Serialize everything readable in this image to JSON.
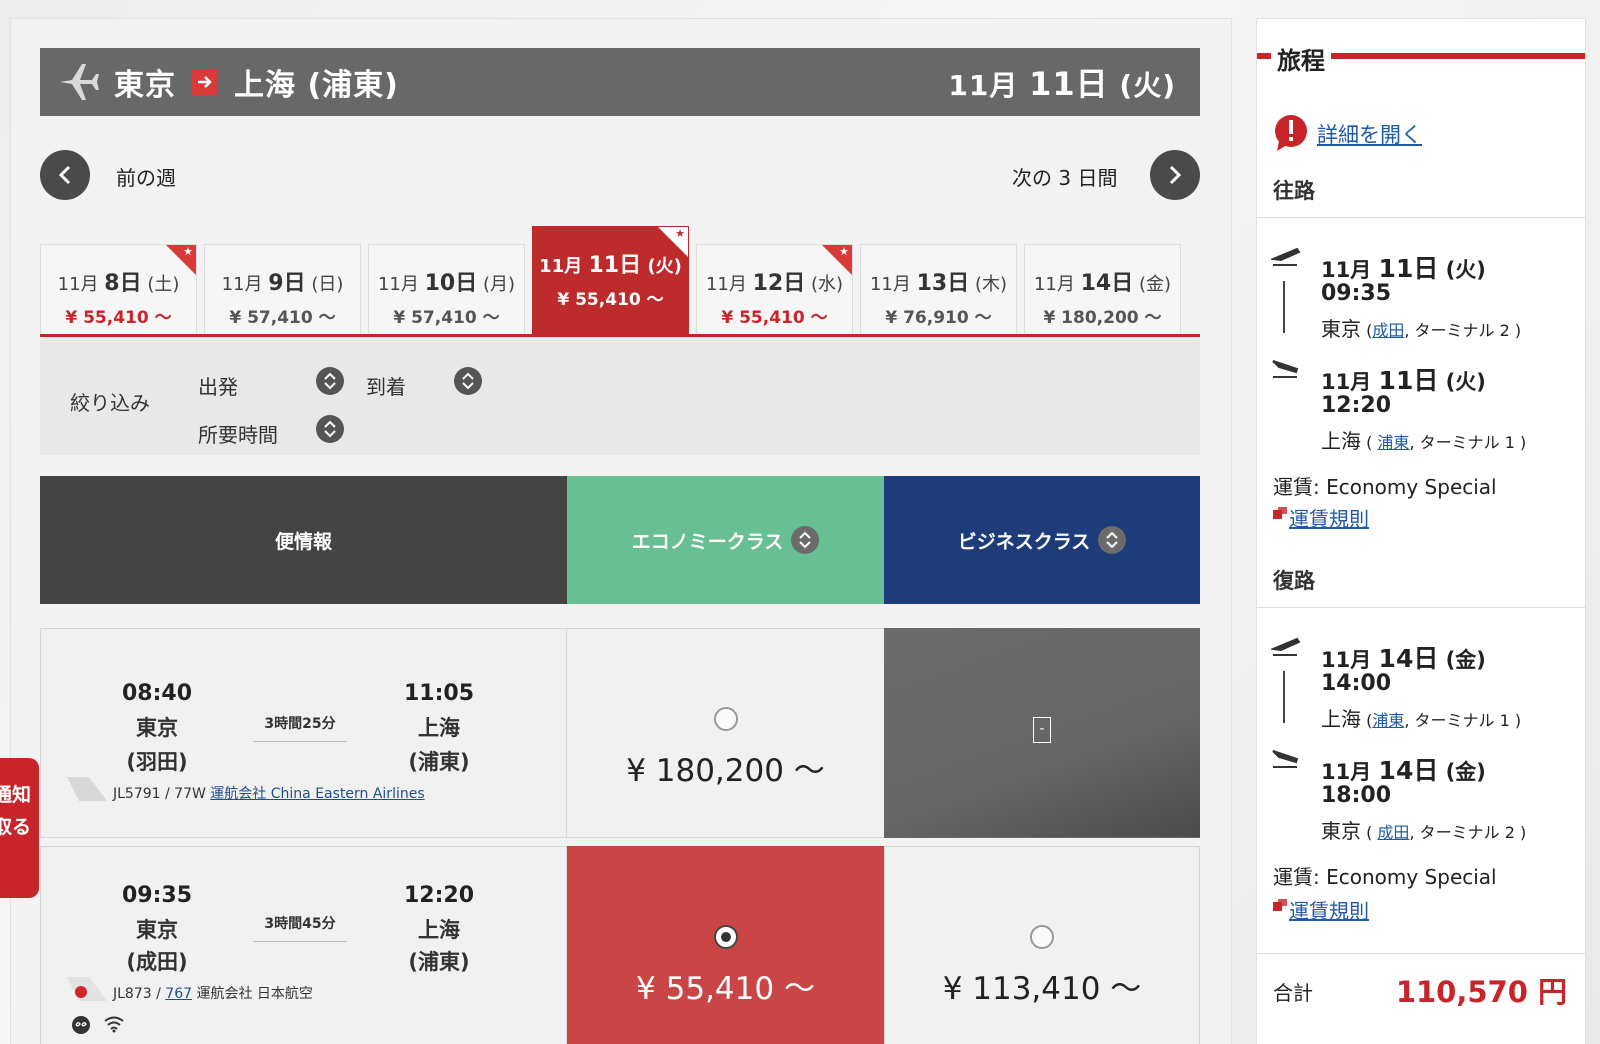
{
  "route": {
    "origin": "東京",
    "destination": "上海 (浦東)",
    "date_prefix": "11月",
    "date_day": "11日",
    "date_suffix": "(火)"
  },
  "nav": {
    "prev_label": "前の週",
    "next_label": "次の 3 日間"
  },
  "date_tabs": [
    {
      "month": "11月",
      "day": "8日",
      "weekday": "(土)",
      "price": "¥ 55,410 ～",
      "lowest": true,
      "selected": false
    },
    {
      "month": "11月",
      "day": "9日",
      "weekday": "(日)",
      "price": "¥ 57,410 ～",
      "lowest": false,
      "selected": false
    },
    {
      "month": "11月",
      "day": "10日",
      "weekday": "(月)",
      "price": "¥ 57,410 ～",
      "lowest": false,
      "selected": false
    },
    {
      "month": "11月",
      "day": "11日",
      "weekday": "(火)",
      "price": "¥ 55,410 ～",
      "lowest": true,
      "selected": true
    },
    {
      "month": "11月",
      "day": "12日",
      "weekday": "(水)",
      "price": "¥ 55,410 ～",
      "lowest": true,
      "selected": false
    },
    {
      "month": "11月",
      "day": "13日",
      "weekday": "(木)",
      "price": "¥ 76,910 ～",
      "lowest": false,
      "selected": false
    },
    {
      "month": "11月",
      "day": "14日",
      "weekday": "(金)",
      "price": "¥ 180,200 ～",
      "lowest": false,
      "selected": false
    }
  ],
  "filter": {
    "title": "絞り込み",
    "departure": "出発",
    "arrival": "到着",
    "duration": "所要時間"
  },
  "class_header": {
    "info": "便情報",
    "economy": "エコノミークラス",
    "business": "ビジネスクラス"
  },
  "flights": [
    {
      "dep_time": "08:40",
      "dep_city": "東京",
      "dep_airport": "(羽田)",
      "arr_time": "11:05",
      "arr_city": "上海",
      "arr_airport": "(浦東)",
      "duration": "3時間25分",
      "flight_no": "JL5791 / 77W",
      "operator_label": "運航会社",
      "operator": "China Eastern Airlines",
      "economy_price": "¥ 180,200 ～",
      "business_na": "-"
    },
    {
      "dep_time": "09:35",
      "dep_city": "東京",
      "dep_airport": "(成田)",
      "arr_time": "12:20",
      "arr_city": "上海",
      "arr_airport": "(浦東)",
      "duration": "3時間45分",
      "flight_no_prefix": "JL873 / ",
      "aircraft": "767",
      "operator_text": " 運航会社 日本航空",
      "economy_price": "¥ 55,410 ～",
      "business_price": "¥ 113,410 ～"
    }
  ],
  "notify_tab": {
    "line1": "通知",
    "line2": "取る"
  },
  "itinerary": {
    "title": "旅程",
    "detail_link": "詳細を開く",
    "outbound": {
      "label": "往路",
      "dep_date_prefix": "11月 ",
      "dep_date_day": "11日",
      "dep_date_suffix": " (火)",
      "dep_time": "09:35",
      "dep_city": "東京",
      "dep_airport": "成田",
      "dep_terminal": "ターミナル 2",
      "arr_date_prefix": "11月 ",
      "arr_date_day": "11日",
      "arr_date_suffix": " (火)",
      "arr_time": "12:20",
      "arr_city": "上海",
      "arr_airport": "浦東",
      "arr_terminal": "ターミナル 1",
      "fare": "運賃: Economy Special",
      "rule_link": "運賃規則"
    },
    "return": {
      "label": "復路",
      "dep_date_prefix": "11月 ",
      "dep_date_day": "14日",
      "dep_date_suffix": " (金)",
      "dep_time": "14:00",
      "dep_city": "上海",
      "dep_airport": "浦東",
      "dep_terminal": "ターミナル 1",
      "arr_date_prefix": "11月 ",
      "arr_date_day": "14日",
      "arr_date_suffix": " (金)",
      "arr_time": "18:00",
      "arr_city": "東京",
      "arr_airport": "成田",
      "arr_terminal": "ターミナル 2",
      "fare": "運賃: Economy Special",
      "rule_link": "運賃規則"
    },
    "total_label": "合計",
    "total_value": "110,570 円"
  },
  "colors": {
    "brand_red": "#c8252b",
    "economy_green": "#69bf94",
    "business_navy": "#1f3c7a",
    "header_gray": "#686868"
  }
}
